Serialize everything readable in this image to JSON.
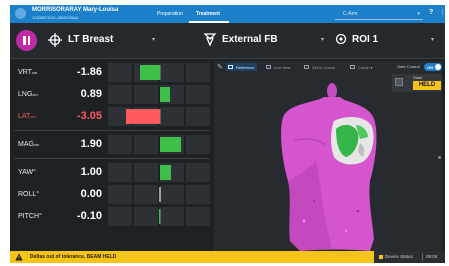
{
  "header": {
    "patient_name": "MORRISORARAY Mary-Louisa",
    "patient_id": "1234567XXX, AB4G28AA",
    "tabs": [
      {
        "label": "Preparation",
        "active": false
      },
      {
        "label": "Treatment",
        "active": true
      }
    ],
    "dropdown_value": "C-Arm",
    "help_symbol": "?",
    "menu_symbol": "⋮",
    "bar_color": "#1c7fc9"
  },
  "toolbar": {
    "site_label": "LT Breast",
    "beam_label": "External FB",
    "roi_label": "ROI 1",
    "pause_color": "#c02aa6"
  },
  "deltas": [
    {
      "id": "vrt",
      "label": "VRT",
      "unit": "cm",
      "value": "-1.86",
      "amount": -1.86,
      "alert": false
    },
    {
      "id": "lng",
      "label": "LNG",
      "unit": "cm",
      "value": "0.89",
      "amount": 0.89,
      "alert": false
    },
    {
      "id": "lat",
      "label": "LAT",
      "unit": "cm",
      "value": "-3.05",
      "amount": -3.05,
      "alert": true
    },
    {
      "id": "mag",
      "label": "MAG",
      "unit": "cm",
      "value": "1.90",
      "amount": 1.9,
      "alert": false
    },
    {
      "id": "yaw",
      "label": "YAW°",
      "unit": "",
      "value": "1.00",
      "amount": 1.0,
      "alert": false
    },
    {
      "id": "roll",
      "label": "ROLL°",
      "unit": "",
      "value": "0.00",
      "amount": 0.0,
      "alert": false
    },
    {
      "id": "pitch",
      "label": "PITCH°",
      "unit": "",
      "value": "-0.10",
      "amount": -0.1,
      "alert": false
    }
  ],
  "colors": {
    "ok": "#3fbf4a",
    "alert": "#ff5a5f",
    "held": "#f4c417"
  },
  "view": {
    "tools": [
      "Reference",
      "Live view",
      "Set to Couch",
      "Couch"
    ],
    "gate_label": "Gate Control",
    "gate_toggle": "ON",
    "state_caption": "State",
    "state_value": "HELD"
  },
  "footer": {
    "message": "Deltas out of tolerance, BEAM HELD",
    "device_status": "Device Status",
    "time": "08:05"
  }
}
